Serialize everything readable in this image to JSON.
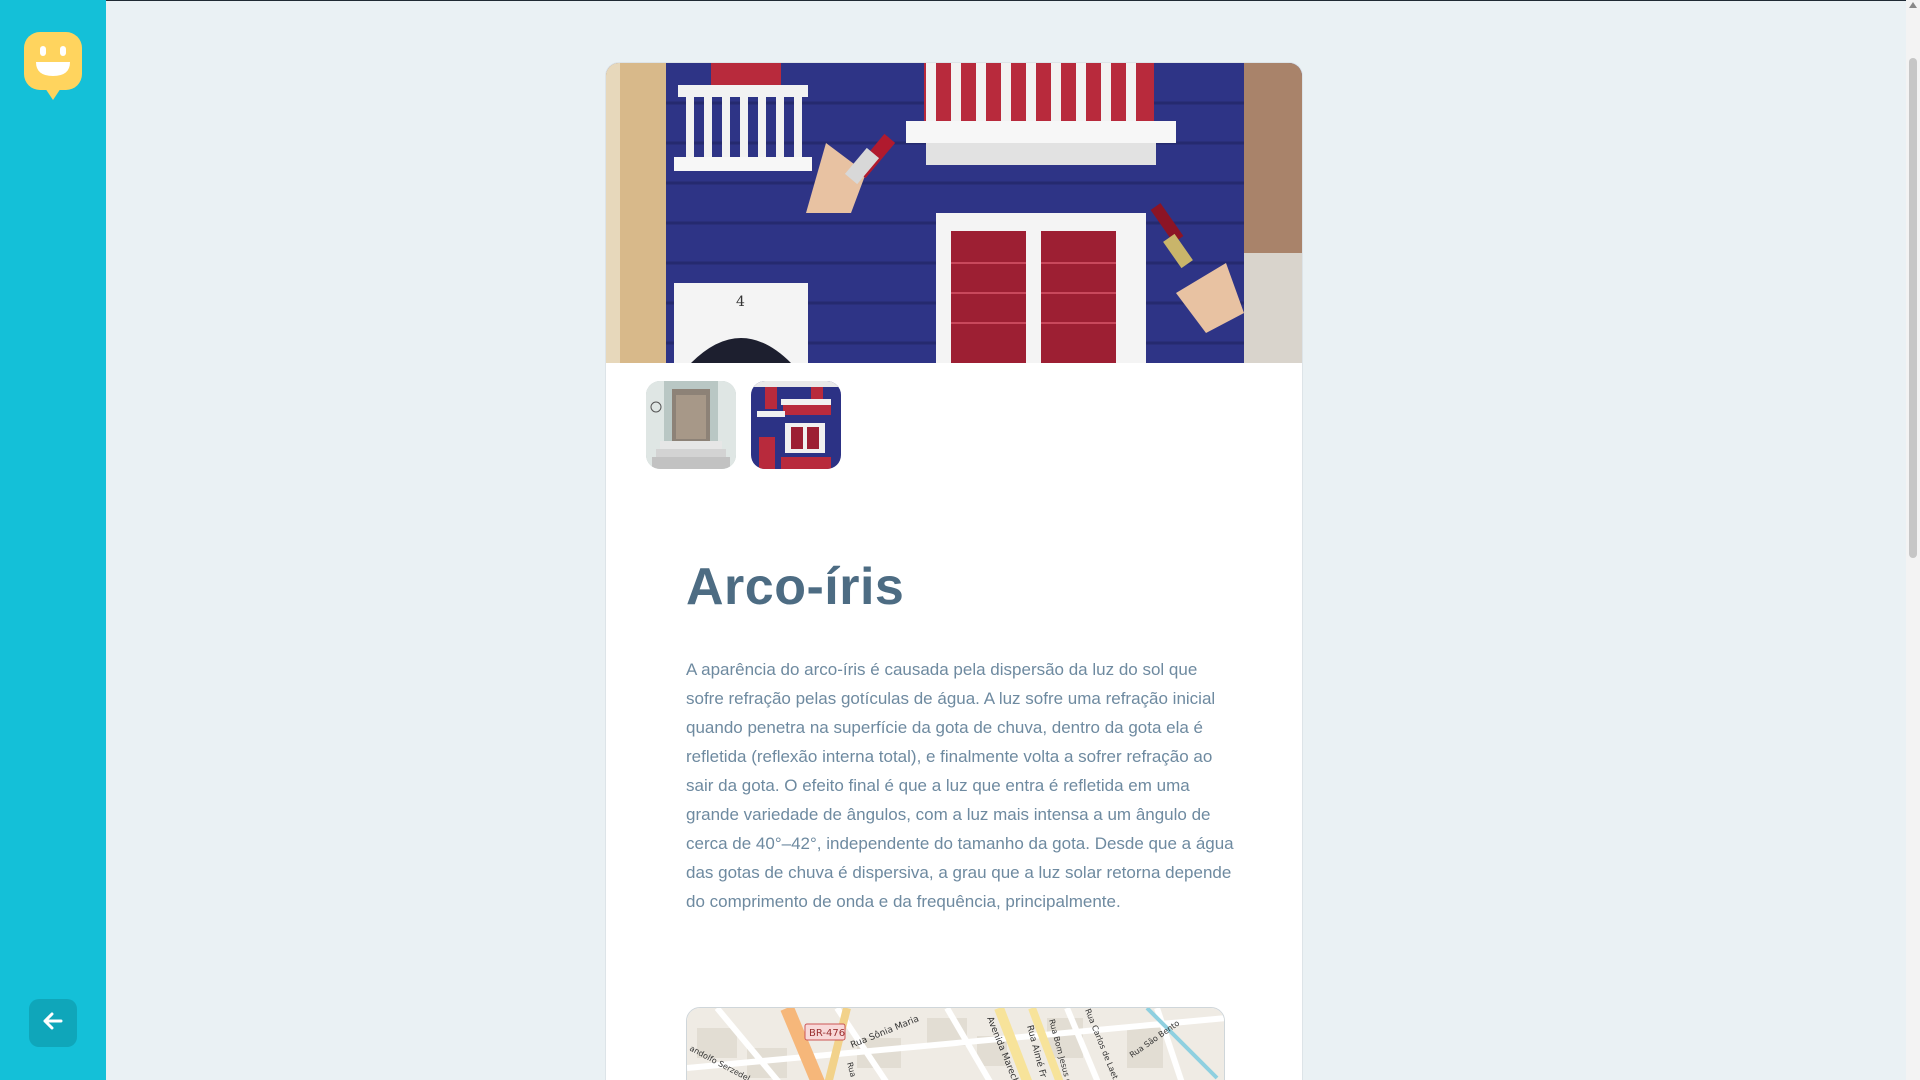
{
  "app": {
    "logo_icon": "smiley-chat-icon",
    "back_icon": "arrow-left-icon"
  },
  "colors": {
    "sidebar": "#14c0d8",
    "back_button": "#0fa6ba",
    "logo": "#ffd45e",
    "title": "#4d6c83",
    "body_text": "#6e8aa0",
    "page_bg": "#eaf1f4"
  },
  "article": {
    "title": "Arco-íris",
    "body": "A aparência do arco-íris é causada pela dispersão da luz do sol que sofre refração pelas gotículas de água. A luz sofre uma refração inicial quando penetra na superfície da gota de chuva, dentro da gota ela é refletida (reflexão interna total), e finalmente volta a sofrer refração ao sair da gota. O efeito final é que a luz que entra é refletida em uma grande variedade de ângulos, com a luz mais intensa a um ângulo de cerca de 40°–42°, independente do tamanho da gota. Desde que a água das gotas de chuva é dispersiva, a grau que a luz solar retorna depende do comprimento de onda e da frequência, principalmente."
  },
  "gallery": {
    "thumbnails": [
      "building-doorway-photo",
      "blue-building-mural-photo"
    ]
  },
  "map": {
    "labels": [
      "BR-476",
      "Rua Sônia Maria",
      "Avenida Marechal",
      "Rua Aimé Fr",
      "Rua Bom Jesus de",
      "Rua Carlos de Laet",
      "Rua São Bento",
      "Rua",
      "andolfo Serzedel"
    ]
  }
}
